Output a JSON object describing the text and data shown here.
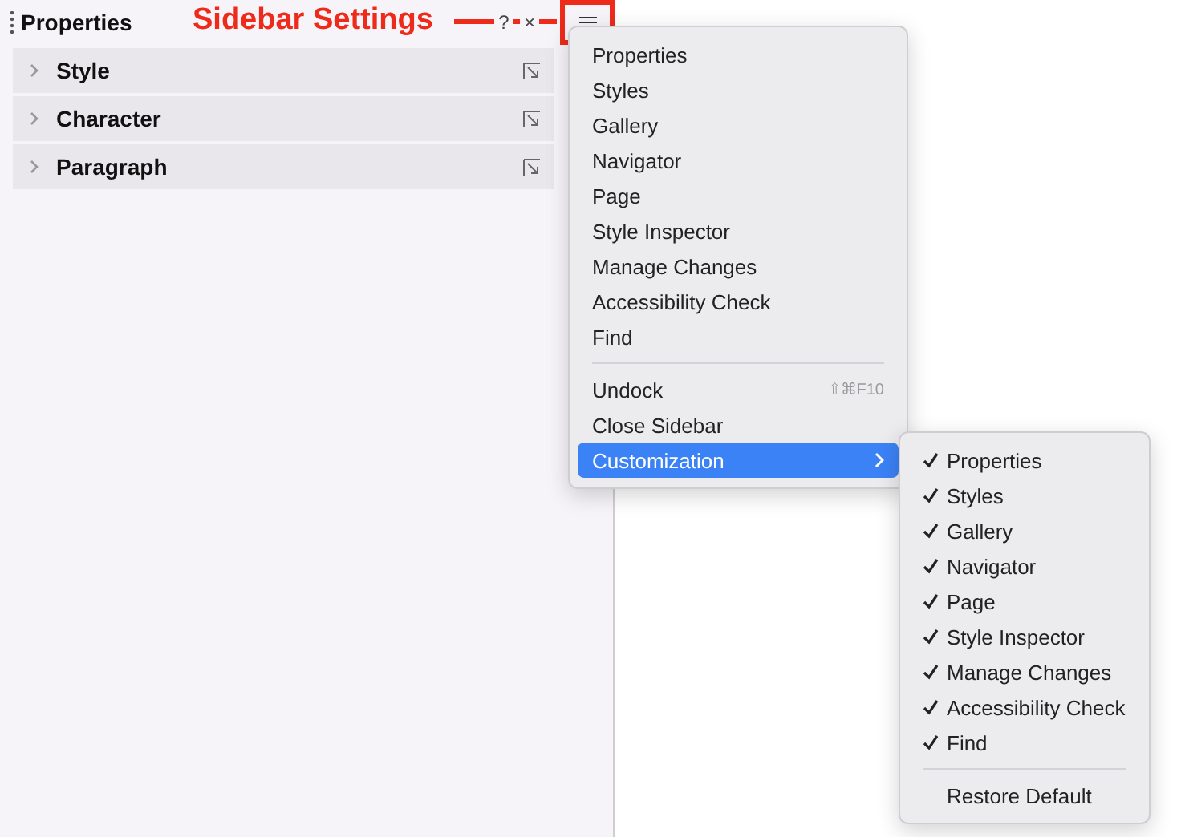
{
  "sidebar": {
    "title": "Properties",
    "help": "?",
    "close": "×",
    "sections": [
      {
        "label": "Style",
        "expanded": false
      },
      {
        "label": "Character",
        "expanded": false
      },
      {
        "label": "Paragraph",
        "expanded": false
      }
    ]
  },
  "annotation": {
    "text": "Sidebar Settings"
  },
  "menu": {
    "groups": [
      [
        {
          "label": "Properties",
          "selected": false
        },
        {
          "label": "Styles",
          "selected": false
        },
        {
          "label": "Gallery",
          "selected": false
        },
        {
          "label": "Navigator",
          "selected": false
        },
        {
          "label": "Page",
          "selected": false
        },
        {
          "label": "Style Inspector",
          "selected": false
        },
        {
          "label": "Manage Changes",
          "selected": false
        },
        {
          "label": "Accessibility Check",
          "selected": false
        },
        {
          "label": "Find",
          "selected": false
        }
      ],
      [
        {
          "label": "Undock",
          "shortcut": "⇧⌘F10",
          "selected": false
        },
        {
          "label": "Close Sidebar",
          "selected": false
        },
        {
          "label": "Customization",
          "submenu": true,
          "selected": true
        }
      ]
    ]
  },
  "submenu": {
    "items": [
      {
        "label": "Properties",
        "checked": true
      },
      {
        "label": "Styles",
        "checked": true
      },
      {
        "label": "Gallery",
        "checked": true
      },
      {
        "label": "Navigator",
        "checked": true
      },
      {
        "label": "Page",
        "checked": true
      },
      {
        "label": "Style Inspector",
        "checked": true
      },
      {
        "label": "Manage Changes",
        "checked": true
      },
      {
        "label": "Accessibility Check",
        "checked": true
      },
      {
        "label": "Find",
        "checked": true
      }
    ],
    "footer": "Restore Default"
  }
}
